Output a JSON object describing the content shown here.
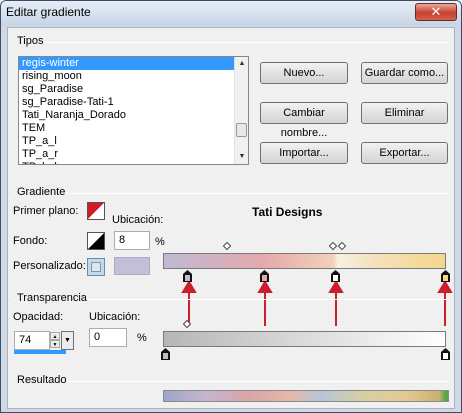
{
  "window": {
    "title": "Editar gradiente"
  },
  "tipos": {
    "group_label": "Tipos",
    "items": [
      "regis-winter",
      "rising_moon",
      "sg_Paradise",
      "sg_Paradise-Tati-1",
      "Tati_Naranja_Dorado",
      "TEM",
      "TP_a_l",
      "TP_a_r",
      "TP_b_l"
    ],
    "selected_index": 0,
    "buttons": {
      "nuevo": "Nuevo...",
      "guardar_como": "Guardar como...",
      "cambiar_nombre": "Cambiar nombre...",
      "eliminar": "Eliminar",
      "importar": "Importar...",
      "exportar": "Exportar..."
    }
  },
  "gradiente": {
    "group_label": "Gradiente",
    "primer_plano_label": "Primer plano:",
    "fondo_label": "Fondo:",
    "personalizado_label": "Personalizado:",
    "ubicacion_label": "Ubicación:",
    "ubicacion_value": "8",
    "percent": "%",
    "gradient_name": "Tati Designs",
    "custom_color": "#c4bfd9"
  },
  "transparencia": {
    "group_label": "Transparencia",
    "opacidad_label": "Opacidad:",
    "opacidad_value": "74",
    "ubicacion_label": "Ubicación:",
    "ubicacion_value": "0",
    "percent": "%"
  },
  "resultado": {
    "group_label": "Resultado"
  },
  "colors": {
    "accent_selection": "#3399ff",
    "annotation_arrow": "#cc1f2e"
  }
}
